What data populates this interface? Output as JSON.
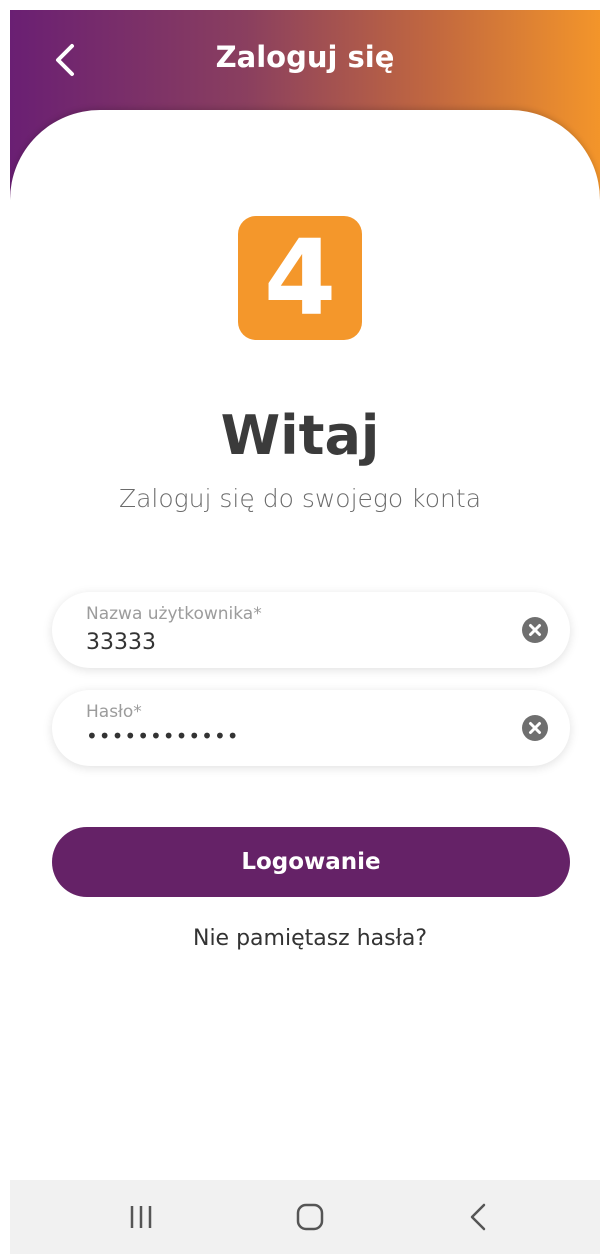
{
  "header": {
    "title": "Zaloguj się",
    "back_icon": "chevron-left-icon",
    "gradient_colors": [
      "#6a1f73",
      "#f3952a"
    ]
  },
  "logo": {
    "text": "4",
    "color": "#f4972b"
  },
  "welcome": {
    "title": "Witaj",
    "subtitle": "Zaloguj się do swojego konta"
  },
  "form": {
    "username": {
      "label": "Nazwa użytkownika*",
      "value": "33333",
      "clear_icon": "clear-icon"
    },
    "password": {
      "label": "Hasło*",
      "value": "••••••••••••",
      "clear_icon": "clear-icon"
    }
  },
  "login_button": {
    "label": "Logowanie",
    "color": "#652267"
  },
  "forgot_password": {
    "label": "Nie pamiętasz hasła?"
  },
  "system_nav": {
    "recents_icon": "recents-icon",
    "home_icon": "home-icon",
    "back_icon": "back-icon"
  }
}
